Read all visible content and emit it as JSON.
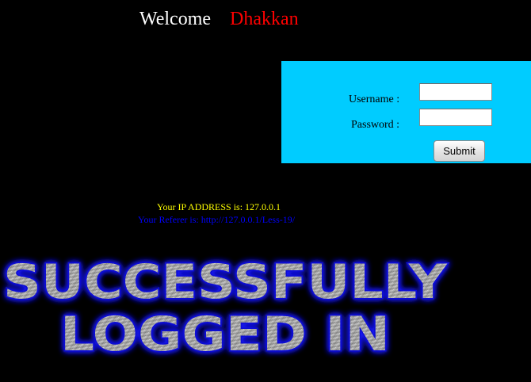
{
  "header": {
    "welcome_label": "Welcome",
    "user_name": "Dhakkan"
  },
  "login_form": {
    "username_label": "Username :",
    "password_label": "Password :",
    "username_value": "",
    "password_value": "",
    "submit_label": "Submit",
    "panel_color": "#00ccff"
  },
  "info": {
    "ip_text": "Your IP ADDRESS is: 127.0.0.1",
    "referer_text": "Your Referer is: http://127.0.0.1/Less-19/"
  },
  "banner": {
    "line1": "SUCCESSFULLY",
    "line2": "LOGGED IN",
    "glow_color": "#1a1aff",
    "fill_color": "#9a9a9a"
  },
  "colors": {
    "background": "#000000",
    "name": "#ff0000",
    "ip_text": "#ffff00",
    "referer_text": "#0000ff"
  }
}
